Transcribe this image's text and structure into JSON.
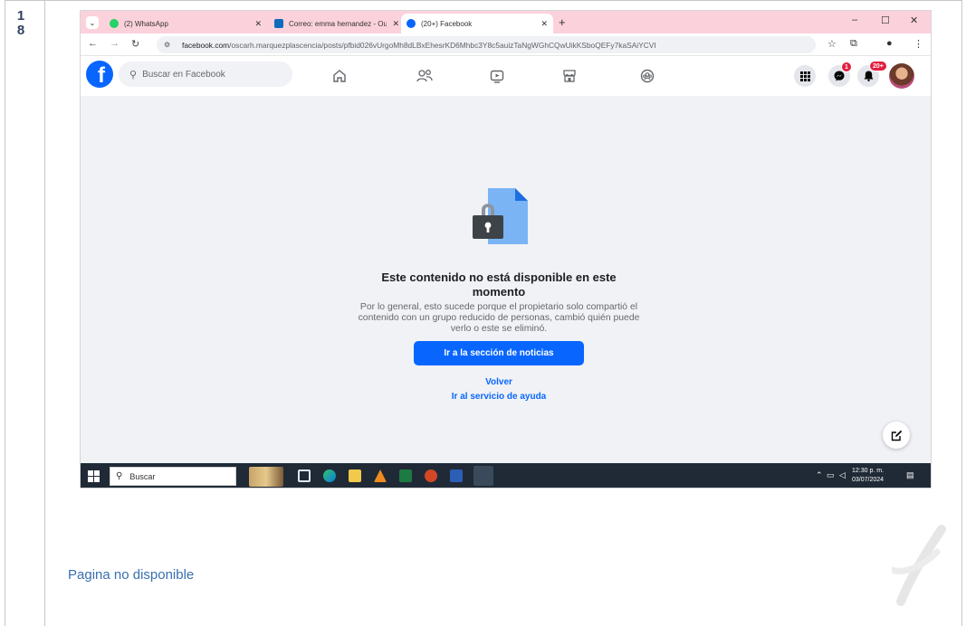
{
  "document": {
    "row_number": "1\n8",
    "caption": "Pagina no disponible"
  },
  "browser": {
    "tabs": [
      {
        "title": "(2) WhatsApp",
        "favicon": "whatsapp-icon",
        "favicon_color": "#25d366"
      },
      {
        "title": "Correo: emma hernandez - Outl",
        "favicon": "outlook-icon",
        "favicon_color": "#0f6cbd"
      },
      {
        "title": "(20+) Facebook",
        "favicon": "facebook-icon",
        "favicon_color": "#0866ff",
        "active": true
      }
    ],
    "url_host": "facebook.com",
    "url_path": "/oscarh.marquezplascencia/posts/pfbid026vUrgoMh8dLBxEhesrKD6Mhbc3Y8c5auizTaNgWGhCQwUikKSboQEFy7kaSAiYCVI",
    "tab_strip_color": "#fbd2dc"
  },
  "facebook": {
    "search_placeholder": "Buscar en Facebook",
    "brand_color": "#0866ff",
    "nav_icons": [
      "home-icon",
      "friends-icon",
      "video-icon",
      "marketplace-icon",
      "groups-icon"
    ],
    "messenger_badge": "1",
    "notifications_badge": "20+",
    "unavailable_title": "Este contenido no está disponible en este momento",
    "unavailable_body": "Por lo general, esto sucede porque el propietario solo compartió el contenido con un grupo reducido de personas, cambió quién puede verlo o este se eliminó.",
    "primary_button": "Ir a la sección de noticias",
    "back_link": "Volver",
    "help_link": "Ir al servicio de ayuda"
  },
  "taskbar": {
    "search_label": "Buscar",
    "time": "12:30 p. m.",
    "date": "03/07/2024"
  }
}
